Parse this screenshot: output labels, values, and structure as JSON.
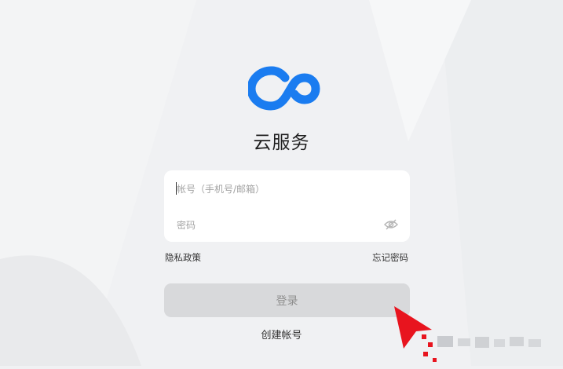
{
  "app": {
    "title": "云服务",
    "logo_icon": "infinity-cloud-logo"
  },
  "login_form": {
    "account_placeholder": "帐号（手机号/邮箱）",
    "account_value": "",
    "password_placeholder": "密码",
    "password_value": "",
    "password_toggle_icon": "eye-off-icon"
  },
  "links": {
    "privacy": "隐私政策",
    "forgot_password": "忘记密码"
  },
  "login_button_label": "登录",
  "create_account_label": "创建帐号",
  "colors": {
    "background": "#f0f1f3",
    "logo_blue": "#1a7cf0",
    "card_bg": "#ffffff",
    "button_disabled_bg": "#d8d9db",
    "button_disabled_text": "#8e8e8e",
    "annotation_arrow": "#e8141e"
  }
}
